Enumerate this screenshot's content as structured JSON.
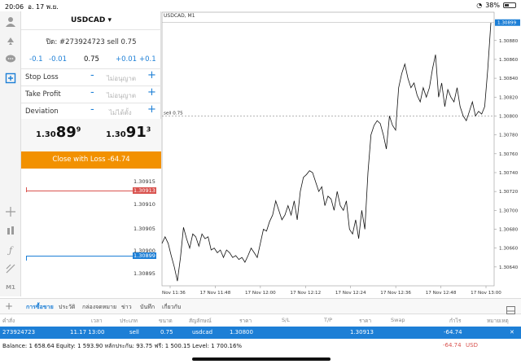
{
  "status": {
    "time": "20:06",
    "date": "อ. 17 พ.ย.",
    "battery": "38%"
  },
  "panel": {
    "symbol": "USDCAD",
    "order_line": "ปิด: #273924723 sell 0.75",
    "vol_minus_big": "-0.1",
    "vol_minus_small": "-0.01",
    "volume": "0.75",
    "vol_plus_small": "+0.01",
    "vol_plus_big": "+0.1",
    "stop_loss_label": "Stop Loss",
    "stop_loss_placeholder": "ไม่อนุญาต",
    "take_profit_label": "Take Profit",
    "take_profit_placeholder": "ไม่อนุญาต",
    "deviation_label": "Deviation",
    "deviation_placeholder": "ไม่ได้ตั้ง",
    "minus": "-",
    "plus": "+",
    "bid_main": "1.30",
    "bid_big": "89",
    "bid_sup": "9",
    "ask_main": "1.30",
    "ask_big": "91",
    "ask_sup": "3",
    "close_button": "Close with Loss -64.74"
  },
  "dom": {
    "levels": [
      "1.30915",
      "1.30913",
      "1.30910",
      "1.30905",
      "1.30900",
      "1.30899",
      "1.30895"
    ],
    "ask_marker": "1.30913",
    "bid_marker": "1.30899"
  },
  "toolbar": {
    "m1_label": "M1"
  },
  "chart_data": {
    "type": "line",
    "title": "USDCAD, M1",
    "sell_line_label": "sell 0.75",
    "sell_price": 1.308,
    "price_marker": "1.30899",
    "y_ticks": [
      "1.30899",
      "1.30880",
      "1.30860",
      "1.30840",
      "1.30820",
      "1.30800",
      "1.30780",
      "1.30760",
      "1.30740",
      "1.30720",
      "1.30700",
      "1.30680",
      "1.30660",
      "1.30640"
    ],
    "x_ticks": [
      "17 Nov 11:36",
      "17 Nov 11:48",
      "17 Nov 12:00",
      "17 Nov 12:12",
      "17 Nov 12:24",
      "17 Nov 12:36",
      "17 Nov 12:48",
      "17 Nov 13:00"
    ],
    "ylim": [
      1.3062,
      1.3091
    ],
    "series": [
      {
        "values": [
          1.30665,
          1.30672,
          1.30665,
          1.30652,
          1.3064,
          1.30625,
          1.3065,
          1.30682,
          1.3067,
          1.3066,
          1.30675,
          1.30672,
          1.30662,
          1.30675,
          1.3067,
          1.30672,
          1.30658,
          1.3066,
          1.30655,
          1.30658,
          1.3065,
          1.30658,
          1.30655,
          1.3065,
          1.30652,
          1.30648,
          1.3065,
          1.30645,
          1.30652,
          1.3066,
          1.30655,
          1.3065,
          1.30665,
          1.3068,
          1.30678,
          1.30688,
          1.30695,
          1.3071,
          1.307,
          1.3069,
          1.30695,
          1.30705,
          1.30695,
          1.3071,
          1.3069,
          1.3072,
          1.30735,
          1.30738,
          1.30742,
          1.3074,
          1.3073,
          1.3072,
          1.30725,
          1.30705,
          1.30715,
          1.30712,
          1.307,
          1.3072,
          1.30705,
          1.307,
          1.3071,
          1.3068,
          1.30675,
          1.3069,
          1.3067,
          1.307,
          1.3068,
          1.3074,
          1.3078,
          1.3079,
          1.30795,
          1.30792,
          1.3078,
          1.30765,
          1.308,
          1.3079,
          1.30785,
          1.3083,
          1.30845,
          1.30855,
          1.3084,
          1.3083,
          1.30835,
          1.30822,
          1.30815,
          1.3083,
          1.3082,
          1.3083,
          1.3085,
          1.30865,
          1.3082,
          1.30835,
          1.3081,
          1.30828,
          1.3082,
          1.30815,
          1.3083,
          1.3081,
          1.308,
          1.30795,
          1.30805,
          1.30815,
          1.308,
          1.30805,
          1.30802,
          1.3081,
          1.3085,
          1.30899
        ]
      }
    ]
  },
  "bottom_tabs": [
    "การซื้อขาย",
    "ประวัติ",
    "กล่องจดหมาย",
    "ข่าว",
    "บันทึก",
    "เกี่ยวกับ"
  ],
  "table": {
    "headers": [
      "คำสั่ง",
      "เวลา",
      "ประเภท",
      "ขนาด",
      "สัญลักษณ์",
      "ราคา",
      "S/L",
      "T/P",
      "ราคา",
      "Swap",
      "กำไร",
      "หมายเหตุ"
    ],
    "row": [
      "273924723",
      "11.17 13:00",
      "sell",
      "0.75",
      "usdcad",
      "1.30800",
      "",
      "",
      "1.30913",
      "",
      "-64.74",
      ""
    ]
  },
  "balance": {
    "text": "Balance: 1 658.64 Equity: 1 593.90 หลักประกัน: 93.75 ฟรี: 1 500.15 Level: 1 700.16%",
    "profit": "-64.74",
    "currency": "USD"
  },
  "colors": {
    "accent": "#1d7fd6",
    "close_button": "#f29100",
    "ask": "#d9534f",
    "bid": "#1d7fd6"
  }
}
